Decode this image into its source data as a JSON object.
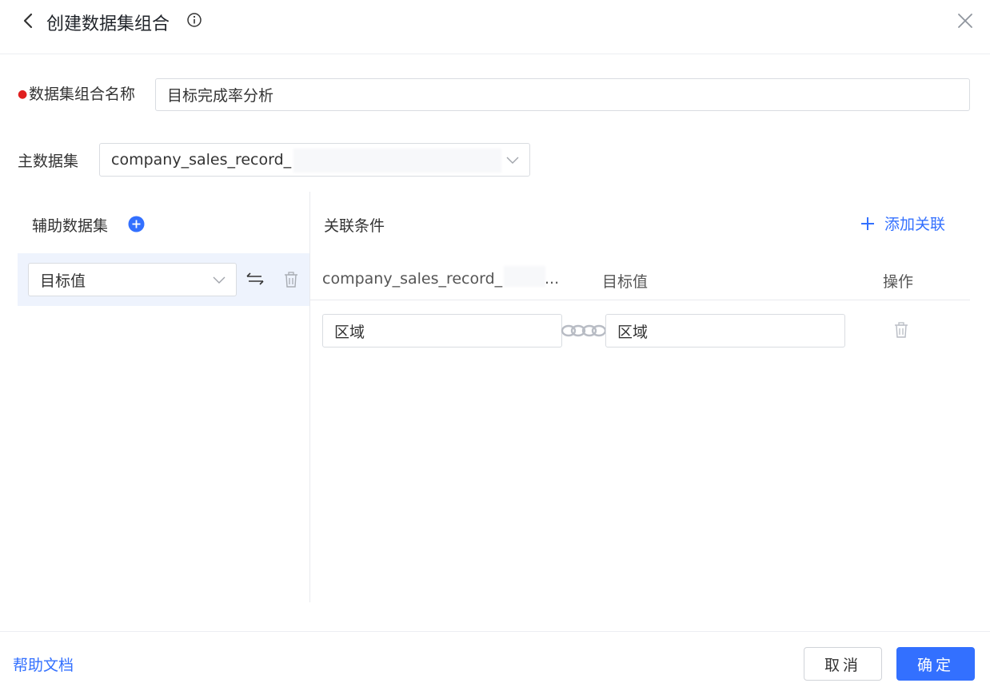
{
  "header": {
    "title": "创建数据集组合",
    "back_icon": "chevron-left-icon",
    "info_icon": "info-icon",
    "close_icon": "close-icon"
  },
  "form": {
    "name_label": "数据集组合名称",
    "name_value": "目标完成率分析",
    "main_dataset_label": "主数据集",
    "main_dataset_value": "company_sales_record_"
  },
  "aux_panel": {
    "title": "辅助数据集",
    "add_icon": "plus-circle-icon",
    "items": [
      {
        "dataset": "目标值",
        "swap_icon": "swap-icon",
        "delete_icon": "trash-icon"
      }
    ]
  },
  "relations": {
    "title": "关联条件",
    "add_label": "添加关联",
    "columns": {
      "left": "company_sales_record_",
      "left_ellipsis": "...",
      "right": "目标值",
      "action": "操作"
    },
    "rows": [
      {
        "left_field": "区域",
        "right_field": "区域",
        "link_icon": "chain-link-icon",
        "delete_icon": "trash-icon"
      }
    ]
  },
  "footer": {
    "help_label": "帮助文档",
    "cancel_label": "取消",
    "confirm_label": "确定"
  },
  "colors": {
    "accent": "#3370ff",
    "required": "#e02020",
    "selected_bg": "#eef3fd",
    "border": "#d9dce1"
  }
}
